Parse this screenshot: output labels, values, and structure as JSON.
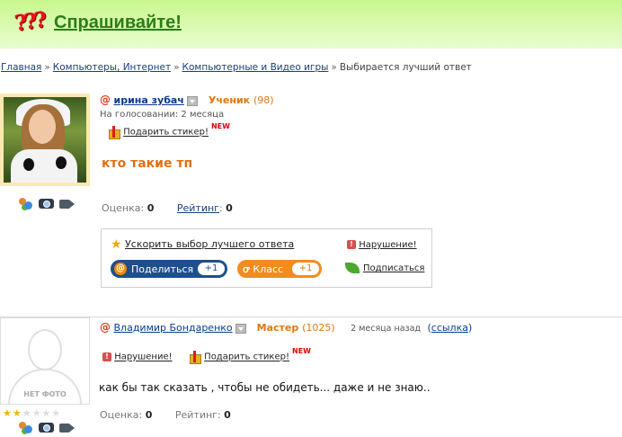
{
  "header": {
    "logo_glyph": "???",
    "title": "Спрашивайте!"
  },
  "breadcrumbs": {
    "items": [
      "Главная",
      "Компьютеры, Интернет",
      "Компьютерные и Видео игры"
    ],
    "separator": "»",
    "current": "Выбирается лучший ответ"
  },
  "question": {
    "author_name": "ирина зубач",
    "rank": "Ученик",
    "rank_points": "(98)",
    "voting_status": "На голосовании: 2 месяца",
    "gift_label": "Подарить стикер!",
    "new_badge": "NEW",
    "title": "кто такие тп",
    "score_label": "Оценка:",
    "score_value": "0",
    "rating_label": "Рейтинг",
    "rating_value": "0",
    "actions": {
      "speed_up": "Ускорить выбор лучшего ответа",
      "violation": "Нарушение!",
      "share_label": "Поделиться",
      "share_count": "+1",
      "klass_label": "Класс",
      "klass_count": "+1",
      "subscribe": "Подписаться"
    }
  },
  "answer": {
    "author_name": "Владимир Бондаренко",
    "rank": "Мастер",
    "rank_points": "(1025)",
    "posted_ago": "2 месяца назад",
    "link_label": "ссылка",
    "no_photo": "НЕТ ФОТО",
    "stars_filled": 2,
    "stars_total": 6,
    "violation": "Нарушение!",
    "gift_label": "Подарить стикер!",
    "new_badge": "NEW",
    "text": "как бы так сказать , чтобы не обидеть... даже и не знаю..",
    "score_label": "Оценка:",
    "score_value": "0",
    "rating_label": "Рейтинг:",
    "rating_value": "0"
  },
  "icons": [
    "people-icon",
    "camera-icon",
    "video-icon",
    "gift-icon",
    "star-icon",
    "warning-icon",
    "leaf-icon",
    "dropdown-icon"
  ],
  "colors": {
    "accent_orange": "#e36f10",
    "link_blue": "#0a3c8c",
    "header_green": "#c9f78e",
    "logo_green": "#2b7d16"
  }
}
